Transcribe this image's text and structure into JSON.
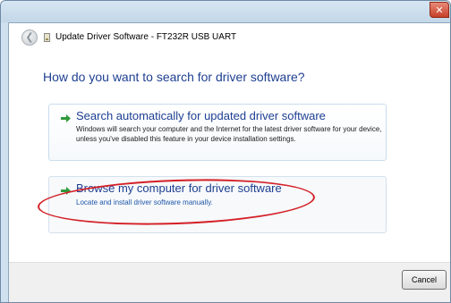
{
  "window": {
    "title": "Update Driver Software - FT232R USB UART",
    "close_glyph": "✕"
  },
  "header": {
    "back_icon": "back-arrow-icon",
    "back_glyph": "❮"
  },
  "main": {
    "question": "How do you want to search for driver software?",
    "options": [
      {
        "title": "Search automatically for updated driver software",
        "description": "Windows will search your computer and the Internet for the latest driver software for your device, unless you've disabled this feature in your device installation settings."
      },
      {
        "title": "Browse my computer for driver software",
        "description": "Locate and install driver software manually."
      }
    ]
  },
  "footer": {
    "cancel_label": "Cancel"
  },
  "colors": {
    "heading_blue": "#1e3f91",
    "link_blue": "#2057a8",
    "arrow_green": "#2f9a3a",
    "annotation_red": "#d41f26"
  }
}
